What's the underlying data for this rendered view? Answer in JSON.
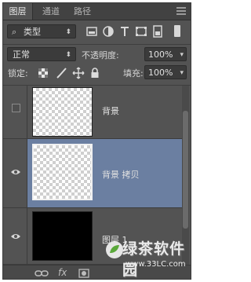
{
  "tabs": [
    {
      "label": "图层",
      "active": true
    },
    {
      "label": "通道",
      "active": false
    },
    {
      "label": "路径",
      "active": false
    }
  ],
  "filter": {
    "kind": "类型",
    "icons": [
      "image-filter-icon",
      "adjustment-filter-icon",
      "type-filter-icon",
      "shape-filter-icon",
      "smart-object-filter-icon"
    ]
  },
  "blend": {
    "mode": "正常",
    "opacity_label": "不透明度:",
    "opacity_value": "100%"
  },
  "lock": {
    "label": "锁定:",
    "fill_label": "填充:",
    "fill_value": "100%"
  },
  "layers": [
    {
      "name": "背景",
      "visible": false,
      "selected": false,
      "thumb": "transparent"
    },
    {
      "name": "背景 拷贝",
      "visible": true,
      "selected": true,
      "thumb": "transparent"
    },
    {
      "name": "图层 1",
      "visible": true,
      "selected": false,
      "thumb": "black"
    }
  ],
  "watermark": {
    "title": "绿茶软件园",
    "url": "www.33LC.com"
  },
  "colors": {
    "panel": "#535353",
    "selected": "#6b7fa1",
    "field": "#3b3b3b"
  }
}
